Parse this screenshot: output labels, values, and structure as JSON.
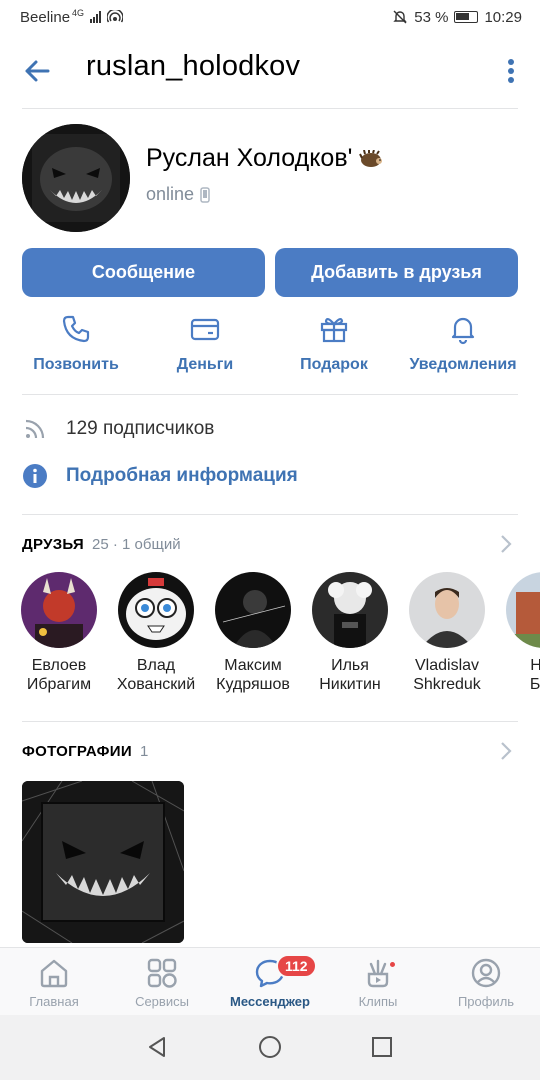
{
  "status_bar": {
    "carrier": "Beeline",
    "network": "4G",
    "battery": "53 %",
    "time": "10:29"
  },
  "header": {
    "username": "ruslan_holodkov"
  },
  "profile": {
    "name": "Руслан Холодков'",
    "status": "online"
  },
  "buttons": {
    "message": "Сообщение",
    "add_friend": "Добавить в друзья"
  },
  "actions": [
    {
      "label": "Позвонить",
      "icon": "phone-icon"
    },
    {
      "label": "Деньги",
      "icon": "card-icon"
    },
    {
      "label": "Подарок",
      "icon": "gift-icon"
    },
    {
      "label": "Уведомления",
      "icon": "bell-icon"
    }
  ],
  "info": {
    "subscribers": "129 подписчиков",
    "details_link": "Подробная информация"
  },
  "friends": {
    "label": "ДРУЗЬЯ",
    "count": "25 · 1 общий",
    "items": [
      {
        "first": "Евлоев",
        "last": "Ибрагим"
      },
      {
        "first": "Влад",
        "last": "Хованский"
      },
      {
        "first": "Максим",
        "last": "Кудряшов"
      },
      {
        "first": "Илья",
        "last": "Никитин"
      },
      {
        "first": "Vladislav",
        "last": "Shkreduk"
      },
      {
        "first": "Ник",
        "last": "Бор"
      }
    ]
  },
  "photos": {
    "label": "ФОТОГРАФИИ",
    "count": "1"
  },
  "tabbar": {
    "items": [
      {
        "label": "Главная",
        "icon": "home-icon"
      },
      {
        "label": "Сервисы",
        "icon": "services-icon"
      },
      {
        "label": "Мессенджер",
        "icon": "messenger-icon",
        "badge": "112"
      },
      {
        "label": "Клипы",
        "icon": "clips-icon"
      },
      {
        "label": "Профиль",
        "icon": "profile-icon"
      }
    ]
  },
  "colors": {
    "accent": "#4b7cc4",
    "link": "#3f73b3",
    "secondary_text": "#818c99",
    "badge": "#e64646"
  }
}
